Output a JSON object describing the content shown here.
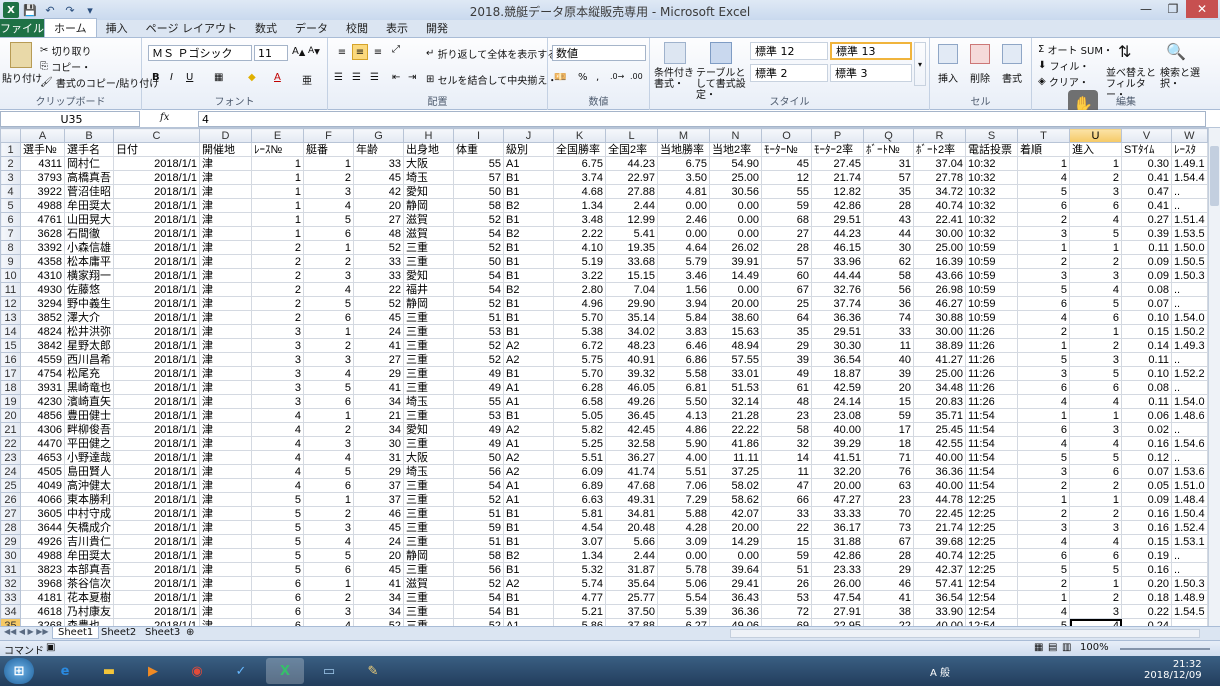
{
  "window": {
    "title": "2018.競艇データ原本縦販売専用 - Microsoft Excel",
    "minimize": "—",
    "restore": "❐",
    "close": "✕"
  },
  "qat": [
    "💾",
    "↶",
    "↷",
    "▾"
  ],
  "tabs": [
    "ファイル",
    "ホーム",
    "挿入",
    "ページ レイアウト",
    "数式",
    "データ",
    "校閲",
    "表示",
    "開発"
  ],
  "ribbon": {
    "clipboard": {
      "paste": "貼り付け",
      "cut": "切り取り",
      "copy": "コピー・",
      "format_painter": "書式のコピー/貼り付け",
      "label": "クリップボード"
    },
    "font": {
      "name": "ＭＳ Ｐゴシック",
      "size": "11",
      "label": "フォント"
    },
    "alignment": {
      "wrap": "折り返して全体を表示する",
      "merge": "セルを結合して中央揃え・",
      "label": "配置"
    },
    "number": {
      "format": "数値",
      "label": "数値"
    },
    "styles": {
      "cond": "条件付き書式・",
      "table": "テーブルとして書式設定・",
      "cells": [
        "標準 12",
        "標準 13",
        "標準 2",
        "標準 3"
      ],
      "label": "スタイル"
    },
    "cells": {
      "insert": "挿入",
      "delete": "削除",
      "format": "書式",
      "label": "セル"
    },
    "editing": {
      "autosum": "オート SUM・",
      "fill": "フィル・",
      "clear": "クリア・",
      "sort": "並べ替えとフィルター・",
      "find": "検索と選択・",
      "label": "編集"
    }
  },
  "formula_bar": {
    "name_box": "U35",
    "fx": "fx",
    "value": "4"
  },
  "columns": [
    "A",
    "B",
    "C",
    "D",
    "E",
    "F",
    "G",
    "H",
    "I",
    "J",
    "K",
    "L",
    "M",
    "N",
    "O",
    "P",
    "Q",
    "R",
    "S",
    "T",
    "U",
    "V",
    "W"
  ],
  "header_row": [
    "選手№",
    "選手名",
    "日付",
    "開催地",
    "ﾚｰｽ№",
    "艇番",
    "年齢",
    "出身地",
    "体重",
    "級別",
    "全国勝率",
    "全国2率",
    "当地勝率",
    "当地2率",
    "ﾓｰﾀｰ№",
    "ﾓｰﾀｰ2率",
    "ﾎﾞｰﾄ№",
    "ﾎﾞｰﾄ2率",
    "電話投票",
    "着順",
    "進入",
    "STﾀｲﾑ",
    "ﾚｰｽﾀ"
  ],
  "rows": [
    [
      "4311",
      "岡村仁",
      "2018/1/1",
      "津",
      "1",
      "1",
      "33",
      "大阪",
      "55",
      "A1",
      "6.75",
      "44.23",
      "6.75",
      "54.90",
      "45",
      "27.45",
      "31",
      "37.04",
      "10:32",
      "1",
      "1",
      "0.30",
      "1.49.1"
    ],
    [
      "3793",
      "高橋真吾",
      "2018/1/1",
      "津",
      "1",
      "2",
      "45",
      "埼玉",
      "57",
      "B1",
      "3.74",
      "22.97",
      "3.50",
      "25.00",
      "12",
      "21.74",
      "57",
      "27.78",
      "10:32",
      "4",
      "2",
      "0.41",
      "1.54.4"
    ],
    [
      "3922",
      "菅沼佳昭",
      "2018/1/1",
      "津",
      "1",
      "3",
      "42",
      "愛知",
      "50",
      "B1",
      "4.68",
      "27.88",
      "4.81",
      "30.56",
      "55",
      "12.82",
      "35",
      "34.72",
      "10:32",
      "5",
      "3",
      "0.47",
      ".."
    ],
    [
      "4988",
      "牟田奨太",
      "2018/1/1",
      "津",
      "1",
      "4",
      "20",
      "静岡",
      "58",
      "B2",
      "1.34",
      "2.44",
      "0.00",
      "0.00",
      "59",
      "42.86",
      "28",
      "40.74",
      "10:32",
      "6",
      "6",
      "0.41",
      ".."
    ],
    [
      "4761",
      "山田晃大",
      "2018/1/1",
      "津",
      "1",
      "5",
      "27",
      "滋賀",
      "52",
      "B1",
      "3.48",
      "12.99",
      "2.46",
      "0.00",
      "68",
      "29.51",
      "43",
      "22.41",
      "10:32",
      "2",
      "4",
      "0.27",
      "1.51.4"
    ],
    [
      "3628",
      "石間徹",
      "2018/1/1",
      "津",
      "1",
      "6",
      "48",
      "滋賀",
      "54",
      "B2",
      "2.22",
      "5.41",
      "0.00",
      "0.00",
      "27",
      "44.23",
      "44",
      "30.00",
      "10:32",
      "3",
      "5",
      "0.39",
      "1.53.5"
    ],
    [
      "3392",
      "小森信雄",
      "2018/1/1",
      "津",
      "2",
      "1",
      "52",
      "三重",
      "52",
      "B1",
      "4.10",
      "19.35",
      "4.64",
      "26.02",
      "28",
      "46.15",
      "30",
      "25.00",
      "10:59",
      "1",
      "1",
      "0.11",
      "1.50.0"
    ],
    [
      "4358",
      "松本庸平",
      "2018/1/1",
      "津",
      "2",
      "2",
      "33",
      "三重",
      "50",
      "B1",
      "5.19",
      "33.68",
      "5.79",
      "39.91",
      "57",
      "33.96",
      "62",
      "16.39",
      "10:59",
      "2",
      "2",
      "0.09",
      "1.50.5"
    ],
    [
      "4310",
      "横家翔一",
      "2018/1/1",
      "津",
      "2",
      "3",
      "33",
      "愛知",
      "54",
      "B1",
      "3.22",
      "15.15",
      "3.46",
      "14.49",
      "60",
      "44.44",
      "58",
      "43.66",
      "10:59",
      "3",
      "3",
      "0.09",
      "1.50.3"
    ],
    [
      "4930",
      "佐藤悠",
      "2018/1/1",
      "津",
      "2",
      "4",
      "22",
      "福井",
      "54",
      "B2",
      "2.80",
      "7.04",
      "1.56",
      "0.00",
      "67",
      "32.76",
      "56",
      "26.98",
      "10:59",
      "5",
      "4",
      "0.08",
      ".."
    ],
    [
      "3294",
      "野中義生",
      "2018/1/1",
      "津",
      "2",
      "5",
      "52",
      "静岡",
      "52",
      "B1",
      "4.96",
      "29.90",
      "3.94",
      "20.00",
      "25",
      "37.74",
      "36",
      "46.27",
      "10:59",
      "6",
      "5",
      "0.07",
      ".."
    ],
    [
      "3852",
      "澤大介",
      "2018/1/1",
      "津",
      "2",
      "6",
      "45",
      "三重",
      "51",
      "B1",
      "5.70",
      "35.14",
      "5.84",
      "38.60",
      "64",
      "36.36",
      "74",
      "30.88",
      "10:59",
      "4",
      "6",
      "0.10",
      "1.54.0"
    ],
    [
      "4824",
      "松井洪弥",
      "2018/1/1",
      "津",
      "3",
      "1",
      "24",
      "三重",
      "53",
      "B1",
      "5.38",
      "34.02",
      "3.83",
      "15.63",
      "35",
      "29.51",
      "33",
      "30.00",
      "11:26",
      "2",
      "1",
      "0.15",
      "1.50.2"
    ],
    [
      "3842",
      "星野太郎",
      "2018/1/1",
      "津",
      "3",
      "2",
      "41",
      "三重",
      "52",
      "A2",
      "6.72",
      "48.23",
      "6.46",
      "48.94",
      "29",
      "30.30",
      "11",
      "38.89",
      "11:26",
      "1",
      "2",
      "0.14",
      "1.49.3"
    ],
    [
      "4559",
      "西川昌希",
      "2018/1/1",
      "津",
      "3",
      "3",
      "27",
      "三重",
      "52",
      "A2",
      "5.75",
      "40.91",
      "6.86",
      "57.55",
      "39",
      "36.54",
      "40",
      "41.27",
      "11:26",
      "5",
      "3",
      "0.11",
      ".."
    ],
    [
      "4754",
      "松尾充",
      "2018/1/1",
      "津",
      "3",
      "4",
      "29",
      "三重",
      "49",
      "B1",
      "5.70",
      "39.32",
      "5.58",
      "33.01",
      "49",
      "18.87",
      "39",
      "25.00",
      "11:26",
      "3",
      "5",
      "0.10",
      "1.52.2"
    ],
    [
      "3931",
      "黒崎竜也",
      "2018/1/1",
      "津",
      "3",
      "5",
      "41",
      "三重",
      "49",
      "A1",
      "6.28",
      "46.05",
      "6.81",
      "51.53",
      "61",
      "42.59",
      "20",
      "34.48",
      "11:26",
      "6",
      "6",
      "0.08",
      ".."
    ],
    [
      "4230",
      "濱崎直矢",
      "2018/1/1",
      "津",
      "3",
      "6",
      "34",
      "埼玉",
      "55",
      "A1",
      "6.58",
      "49.26",
      "5.50",
      "32.14",
      "48",
      "24.14",
      "15",
      "20.83",
      "11:26",
      "4",
      "4",
      "0.11",
      "1.54.0"
    ],
    [
      "4856",
      "豊田健士",
      "2018/1/1",
      "津",
      "4",
      "1",
      "21",
      "三重",
      "53",
      "B1",
      "5.05",
      "36.45",
      "4.13",
      "21.28",
      "23",
      "23.08",
      "59",
      "35.71",
      "11:54",
      "1",
      "1",
      "0.06",
      "1.48.6"
    ],
    [
      "4306",
      "畔柳俊吾",
      "2018/1/1",
      "津",
      "4",
      "2",
      "34",
      "愛知",
      "49",
      "A2",
      "5.82",
      "42.45",
      "4.86",
      "22.22",
      "58",
      "40.00",
      "17",
      "25.45",
      "11:54",
      "6",
      "3",
      "0.02",
      ".."
    ],
    [
      "4470",
      "平田健之",
      "2018/1/1",
      "津",
      "4",
      "3",
      "30",
      "三重",
      "49",
      "A1",
      "5.25",
      "32.58",
      "5.90",
      "41.86",
      "32",
      "39.29",
      "18",
      "42.55",
      "11:54",
      "4",
      "4",
      "0.16",
      "1.54.6"
    ],
    [
      "4653",
      "小野達哉",
      "2018/1/1",
      "津",
      "4",
      "4",
      "31",
      "大阪",
      "50",
      "A2",
      "5.51",
      "36.27",
      "4.00",
      "11.11",
      "14",
      "41.51",
      "71",
      "40.00",
      "11:54",
      "5",
      "5",
      "0.12",
      ".."
    ],
    [
      "4505",
      "島田賢人",
      "2018/1/1",
      "津",
      "4",
      "5",
      "29",
      "埼玉",
      "56",
      "A2",
      "6.09",
      "41.74",
      "5.51",
      "37.25",
      "11",
      "32.20",
      "76",
      "36.36",
      "11:54",
      "3",
      "6",
      "0.07",
      "1.53.6"
    ],
    [
      "4049",
      "高沖健太",
      "2018/1/1",
      "津",
      "4",
      "6",
      "37",
      "三重",
      "54",
      "A1",
      "6.89",
      "47.68",
      "7.06",
      "58.02",
      "47",
      "20.00",
      "63",
      "40.00",
      "11:54",
      "2",
      "2",
      "0.05",
      "1.51.0"
    ],
    [
      "4066",
      "東本勝利",
      "2018/1/1",
      "津",
      "5",
      "1",
      "37",
      "三重",
      "52",
      "A1",
      "6.63",
      "49.31",
      "7.29",
      "58.62",
      "66",
      "47.27",
      "23",
      "44.78",
      "12:25",
      "1",
      "1",
      "0.09",
      "1.48.4"
    ],
    [
      "3605",
      "中村守成",
      "2018/1/1",
      "津",
      "5",
      "2",
      "46",
      "三重",
      "51",
      "B1",
      "5.81",
      "34.81",
      "5.88",
      "42.07",
      "33",
      "33.33",
      "70",
      "22.45",
      "12:25",
      "2",
      "2",
      "0.16",
      "1.50.4"
    ],
    [
      "3644",
      "矢橋成介",
      "2018/1/1",
      "津",
      "5",
      "3",
      "45",
      "三重",
      "59",
      "B1",
      "4.54",
      "20.48",
      "4.28",
      "20.00",
      "22",
      "36.17",
      "73",
      "21.74",
      "12:25",
      "3",
      "3",
      "0.16",
      "1.52.4"
    ],
    [
      "4926",
      "吉川貴仁",
      "2018/1/1",
      "津",
      "5",
      "4",
      "24",
      "三重",
      "51",
      "B1",
      "3.07",
      "5.66",
      "3.09",
      "14.29",
      "15",
      "31.88",
      "67",
      "39.68",
      "12:25",
      "4",
      "4",
      "0.15",
      "1.53.1"
    ],
    [
      "4988",
      "牟田奨太",
      "2018/1/1",
      "津",
      "5",
      "5",
      "20",
      "静岡",
      "58",
      "B2",
      "1.34",
      "2.44",
      "0.00",
      "0.00",
      "59",
      "42.86",
      "28",
      "40.74",
      "12:25",
      "6",
      "6",
      "0.19",
      ".."
    ],
    [
      "3823",
      "本部真吾",
      "2018/1/1",
      "津",
      "5",
      "6",
      "45",
      "三重",
      "56",
      "B1",
      "5.32",
      "31.87",
      "5.78",
      "39.64",
      "51",
      "23.33",
      "29",
      "42.37",
      "12:25",
      "5",
      "5",
      "0.16",
      ".."
    ],
    [
      "3968",
      "茶谷信次",
      "2018/1/1",
      "津",
      "6",
      "1",
      "41",
      "滋賀",
      "52",
      "A2",
      "5.74",
      "35.64",
      "5.06",
      "29.41",
      "26",
      "26.00",
      "46",
      "57.41",
      "12:54",
      "2",
      "1",
      "0.20",
      "1.50.3"
    ],
    [
      "4181",
      "花本夏樹",
      "2018/1/1",
      "津",
      "6",
      "2",
      "34",
      "三重",
      "54",
      "B1",
      "4.77",
      "25.77",
      "5.54",
      "36.43",
      "53",
      "47.54",
      "41",
      "36.54",
      "12:54",
      "1",
      "2",
      "0.18",
      "1.48.9"
    ],
    [
      "4618",
      "乃村康友",
      "2018/1/1",
      "津",
      "6",
      "3",
      "34",
      "三重",
      "54",
      "B1",
      "5.21",
      "37.50",
      "5.39",
      "36.36",
      "72",
      "27.91",
      "38",
      "33.90",
      "12:54",
      "4",
      "3",
      "0.22",
      "1.54.5"
    ],
    [
      "3268",
      "森豊也",
      "2018/1/1",
      "津",
      "6",
      "4",
      "52",
      "三重",
      "52",
      "A1",
      "5.86",
      "37.88",
      "6.27",
      "49.06",
      "69",
      "22.95",
      "22",
      "40.00",
      "12:54",
      "5",
      "4",
      "0.24",
      ""
    ]
  ],
  "sheets": [
    "Sheet1",
    "Sheet2",
    "Sheet3"
  ],
  "status": {
    "mode": "コマンド",
    "zoom": "100%"
  },
  "taskbar": {
    "ime": "A 般",
    "time": "21:32",
    "date": "2018/12/09"
  }
}
